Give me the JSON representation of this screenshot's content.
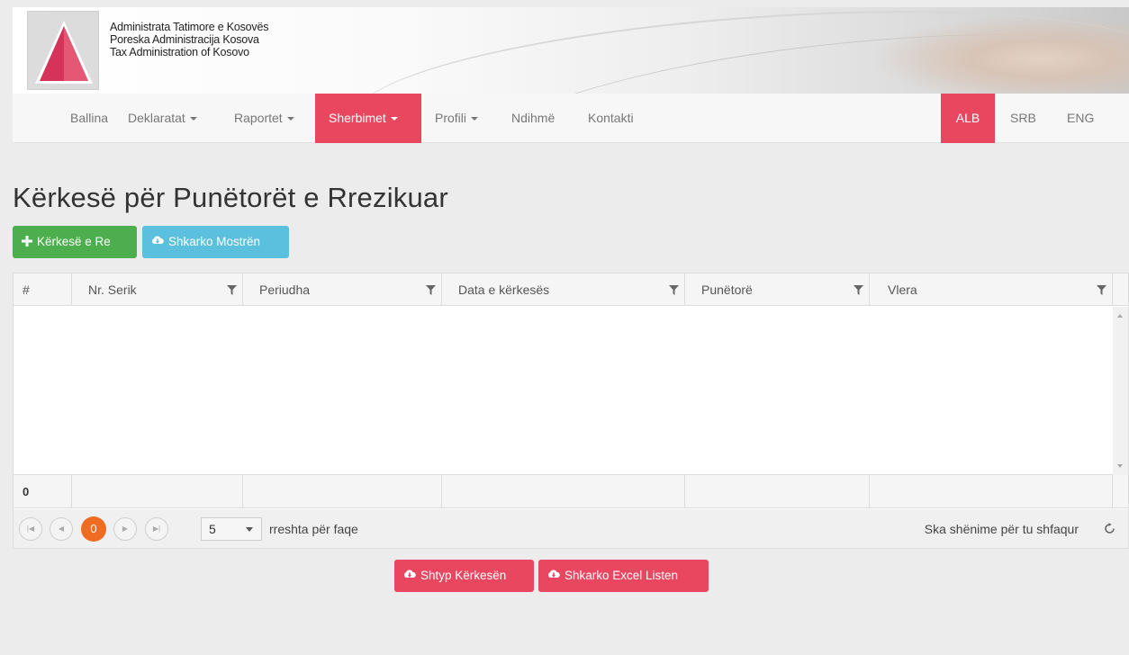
{
  "header": {
    "org_lines": [
      "Administrata Tatimore e Kosovës",
      "Poreska Administracija Kosova",
      "Tax Administration of Kosovo"
    ],
    "accent_color": "#e9465f"
  },
  "nav": {
    "items": [
      {
        "label": "Ballina",
        "dropdown": false
      },
      {
        "label": "Deklaratat",
        "dropdown": true
      },
      {
        "label": "Raportet",
        "dropdown": true
      },
      {
        "label": "Sherbimet",
        "dropdown": true,
        "active": true
      },
      {
        "label": "Profili",
        "dropdown": true
      },
      {
        "label": "Ndihmë",
        "dropdown": false
      },
      {
        "label": "Kontakti",
        "dropdown": false
      }
    ],
    "languages": [
      {
        "label": "ALB",
        "active": true
      },
      {
        "label": "SRB",
        "active": false
      },
      {
        "label": "ENG",
        "active": false
      }
    ]
  },
  "page": {
    "title": "Kërkesë për Punëtorët e Rrezikuar",
    "new_request_label": "Kërkesë e Re",
    "download_sample_label": "Shkarko Mostrën"
  },
  "grid": {
    "columns": [
      "#",
      "Nr. Serik",
      "Periudha",
      "Data e kërkesës",
      "Punëtorë",
      "Vlera"
    ],
    "footer_count": "0",
    "pager": {
      "current_page": "0",
      "page_size": "5",
      "page_size_label": "rreshta për faqe",
      "info": "Ska shënime për tu shfaqur"
    }
  },
  "actions": {
    "print_label": "Shtyp Kërkesën",
    "excel_label": "Shkarko Excel Listen"
  },
  "icons": [
    "plus-icon",
    "cloud-download-icon",
    "filter-icon",
    "first-page-icon",
    "prev-page-icon",
    "next-page-icon",
    "last-page-icon",
    "refresh-icon"
  ]
}
